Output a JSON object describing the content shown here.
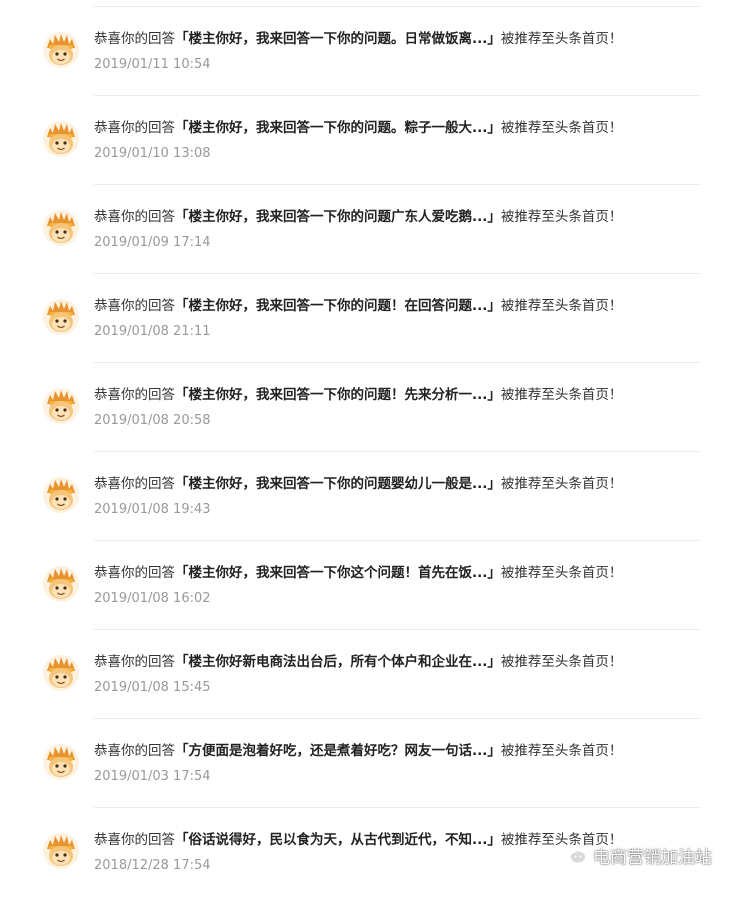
{
  "notifications": [
    {
      "prefix": "恭喜你的回答",
      "title": "「楼主你好，我来回答一下你的问题。日常做饭离...」",
      "suffix": "被推荐至头条首页！",
      "time": "2019/01/11 10:54"
    },
    {
      "prefix": "恭喜你的回答",
      "title": "「楼主你好，我来回答一下你的问题。粽子一般大...」",
      "suffix": "被推荐至头条首页！",
      "time": "2019/01/10 13:08"
    },
    {
      "prefix": "恭喜你的回答",
      "title": "「楼主你好，我来回答一下你的问题广东人爱吃鹅...」",
      "suffix": "被推荐至头条首页！",
      "time": "2019/01/09 17:14"
    },
    {
      "prefix": "恭喜你的回答",
      "title": "「楼主你好，我来回答一下你的问题！在回答问题...」",
      "suffix": "被推荐至头条首页！",
      "time": "2019/01/08 21:11"
    },
    {
      "prefix": "恭喜你的回答",
      "title": "「楼主你好，我来回答一下你的问题！先来分析一...」",
      "suffix": "被推荐至头条首页！",
      "time": "2019/01/08 20:58"
    },
    {
      "prefix": "恭喜你的回答",
      "title": "「楼主你好，我来回答一下你的问题婴幼儿一般是...」",
      "suffix": "被推荐至头条首页！",
      "time": "2019/01/08 19:43"
    },
    {
      "prefix": "恭喜你的回答",
      "title": "「楼主你好，我来回答一下你这个问题！首先在饭...」",
      "suffix": "被推荐至头条首页！",
      "time": "2019/01/08 16:02"
    },
    {
      "prefix": "恭喜你的回答",
      "title": "「楼主你好新电商法出台后，所有个体户和企业在...」",
      "suffix": "被推荐至头条首页！",
      "time": "2019/01/08 15:45"
    },
    {
      "prefix": "恭喜你的回答",
      "title": "「方便面是泡着好吃，还是煮着好吃？网友一句话...」",
      "suffix": "被推荐至头条首页！",
      "time": "2019/01/03 17:54"
    },
    {
      "prefix": "恭喜你的回答",
      "title": "「俗话说得好，民以食为天，从古代到近代，不知...」",
      "suffix": "被推荐至头条首页！",
      "time": "2018/12/28 17:54"
    }
  ],
  "avatar_icon": "monkey-king-icon",
  "watermark": {
    "icon": "wechat-icon",
    "text": "电商营销加油站"
  },
  "colors": {
    "title_text": "#222222",
    "body_text": "#333333",
    "time_text": "#999999",
    "divider": "#ececec",
    "avatar_face": "#f6c47b",
    "avatar_hair": "#e8932e"
  }
}
